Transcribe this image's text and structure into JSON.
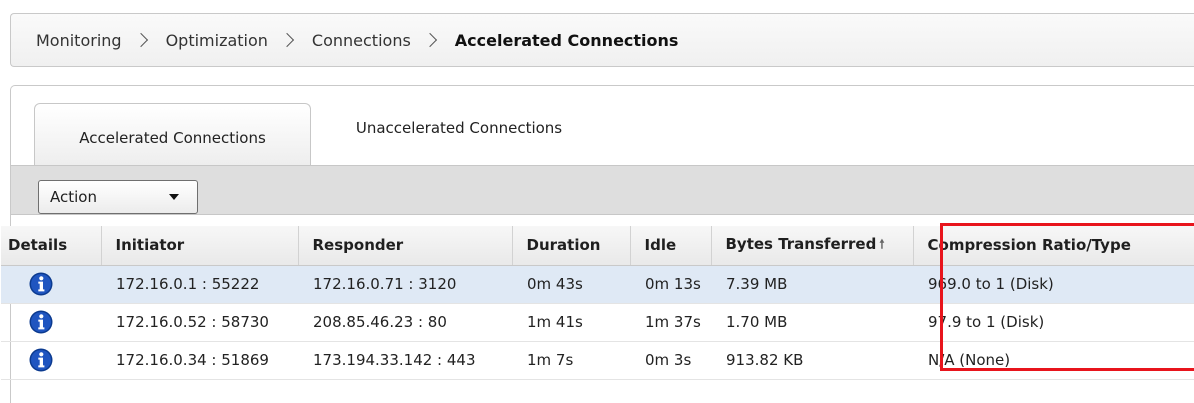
{
  "breadcrumb": {
    "items": [
      "Monitoring",
      "Optimization",
      "Connections"
    ],
    "current": "Accelerated Connections"
  },
  "tabs": [
    {
      "label": "Accelerated Connections",
      "active": true
    },
    {
      "label": "Unaccelerated Connections",
      "active": false
    }
  ],
  "toolbar": {
    "action_label": "Action"
  },
  "table": {
    "columns": [
      "Details",
      "Initiator",
      "Responder",
      "Duration",
      "Idle",
      "Bytes Transferred",
      "Compression Ratio/Type"
    ],
    "sorted_column": "Bytes Transferred",
    "sort_direction": "ascending",
    "rows": [
      {
        "initiator": "172.16.0.1 : 55222",
        "responder": "172.16.0.71 : 3120",
        "duration": "0m 43s",
        "idle": "0m 13s",
        "bytes": "7.39 MB",
        "compression": "969.0 to 1 (Disk)",
        "selected": true
      },
      {
        "initiator": "172.16.0.52 : 58730",
        "responder": "208.85.46.23 : 80",
        "duration": "1m 41s",
        "idle": "1m 37s",
        "bytes": "1.70 MB",
        "compression": "97.9 to 1 (Disk)",
        "selected": false
      },
      {
        "initiator": "172.16.0.34 : 51869",
        "responder": "173.194.33.142 : 443",
        "duration": "1m 7s",
        "idle": "0m 3s",
        "bytes": "913.82 KB",
        "compression": "N/A (None)",
        "selected": false
      }
    ]
  },
  "colors": {
    "info_icon": "#0b3a8f",
    "highlight": "#e8141c",
    "selected_row": "#dfe9f5"
  }
}
